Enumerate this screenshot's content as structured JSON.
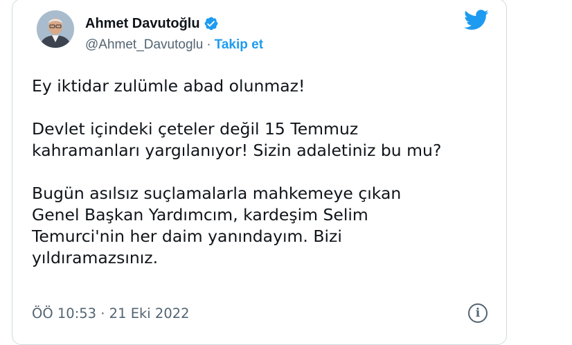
{
  "author": {
    "display_name": "Ahmet Davutoğlu",
    "handle": "@Ahmet_Davutoglu",
    "separator": "·",
    "follow_label": "Takip et",
    "verified": true
  },
  "tweet": {
    "paragraphs": [
      [
        "Ey iktidar zulümle abad olunmaz!"
      ],
      [
        "Devlet içindeki çeteler değil 15 Temmuz",
        "kahramanları yargılanıyor! Sizin adaletiniz bu mu?"
      ],
      [
        "Bugün asılsız suçlamalarla mahkemeye çıkan",
        "Genel Başkan Yardımcım, kardeşim Selim",
        "Temurci'nin her daim yanındayım. Bizi",
        "yıldıramazsınız."
      ]
    ],
    "timestamp": "ÖÖ 10:53 · 21 Eki 2022",
    "info_glyph": "i"
  },
  "colors": {
    "brand": "#1d9bf0",
    "text": "#0f1419",
    "muted": "#536471",
    "border": "#cfd9de"
  },
  "icons": {
    "platform": "twitter-bird-icon",
    "badge": "verified-badge-icon",
    "info": "info-circle-icon"
  }
}
